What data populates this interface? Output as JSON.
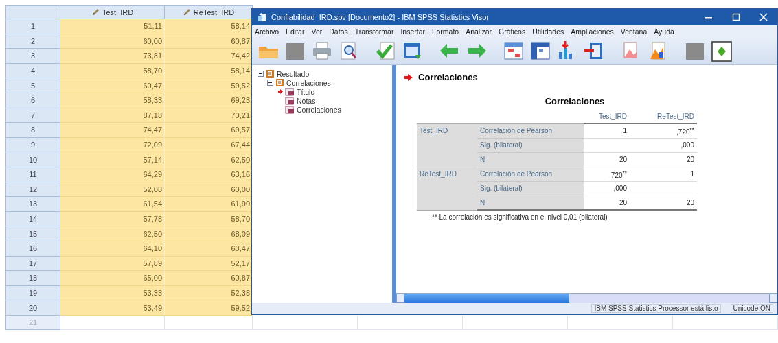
{
  "data_editor": {
    "columns": [
      "Test_IRD",
      "ReTest_IRD"
    ],
    "rows": [
      {
        "label": "1",
        "values": [
          "51,11",
          "58,14"
        ]
      },
      {
        "label": "2",
        "values": [
          "60,00",
          "60,87"
        ]
      },
      {
        "label": "3",
        "values": [
          "73,81",
          "74,42"
        ]
      },
      {
        "label": "4",
        "values": [
          "58,70",
          "58,14"
        ]
      },
      {
        "label": "5",
        "values": [
          "60,47",
          "59,52"
        ]
      },
      {
        "label": "6",
        "values": [
          "58,33",
          "69,23"
        ]
      },
      {
        "label": "7",
        "values": [
          "87,18",
          "70,21"
        ]
      },
      {
        "label": "8",
        "values": [
          "74,47",
          "69,57"
        ]
      },
      {
        "label": "9",
        "values": [
          "72,09",
          "67,44"
        ]
      },
      {
        "label": "10",
        "values": [
          "57,14",
          "62,50"
        ]
      },
      {
        "label": "11",
        "values": [
          "64,29",
          "63,16"
        ]
      },
      {
        "label": "12",
        "values": [
          "52,08",
          "60,00"
        ]
      },
      {
        "label": "13",
        "values": [
          "61,54",
          "61,90"
        ]
      },
      {
        "label": "14",
        "values": [
          "57,78",
          "58,70"
        ]
      },
      {
        "label": "15",
        "values": [
          "62,50",
          "68,09"
        ]
      },
      {
        "label": "16",
        "values": [
          "64,10",
          "60,47"
        ]
      },
      {
        "label": "17",
        "values": [
          "57,89",
          "52,17"
        ]
      },
      {
        "label": "18",
        "values": [
          "65,00",
          "60,87"
        ]
      },
      {
        "label": "19",
        "values": [
          "53,33",
          "52,38"
        ]
      },
      {
        "label": "20",
        "values": [
          "53,49",
          "59,52"
        ]
      }
    ],
    "empty_rows": [
      "21"
    ]
  },
  "viewer": {
    "title": "Confiabilidad_IRD.spv [Documento2] - IBM SPSS Statistics Visor",
    "menu": [
      "Archivo",
      "Editar",
      "Ver",
      "Datos",
      "Transformar",
      "Insertar",
      "Formato",
      "Analizar",
      "Gráficos",
      "Utilidades",
      "Ampliaciones",
      "Ventana",
      "Ayuda"
    ],
    "outline": [
      {
        "label": "Resultado",
        "expanded": true,
        "children": [
          {
            "label": "Correlaciones",
            "expanded": true,
            "children": [
              {
                "label": "Título",
                "selected": true
              },
              {
                "label": "Notas",
                "selected": false
              },
              {
                "label": "Correlaciones",
                "selected": false
              }
            ]
          }
        ]
      }
    ],
    "output": {
      "heading": "Correlaciones",
      "table": {
        "title": "Correlaciones",
        "columns": [
          "Test_IRD",
          "ReTest_IRD"
        ],
        "groups": [
          {
            "label": "Test_IRD",
            "rows": [
              {
                "statistic": "Correlación de Pearson",
                "column_1": "1",
                "column_2": ",720$^{**}$"
              },
              {
                "statistic": "Sig. (bilateral)",
                "column_2": ",000"
              },
              {
                "statistic": "N",
                "column_1": "20",
                "column_2": "20"
              }
            ]
          },
          {
            "label": "ReTest_IRD",
            "rows": [
              {
                "statistic": "Correlación de Pearson",
                "column_1": ",720$^{**}$",
                "column_2": "1"
              },
              {
                "statistic": "Sig. (bilateral)",
                "column_1": ",000"
              },
              {
                "statistic": "N",
                "column_1": "20",
                "column_2": "20"
              }
            ]
          }
        ]
      },
      "footnote": "** La correlación es significativa en el nivel 0,01 (bilateral)"
    },
    "status_bar": [
      "IBM SPSS Statistics Processor está listo",
      "Unicode:ON"
    ]
  }
}
